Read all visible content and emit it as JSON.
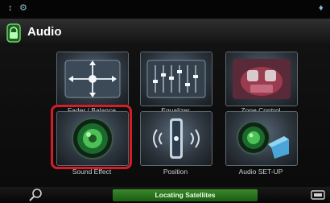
{
  "status_bar": {
    "icon_left": "↕",
    "icon_mid": "⚙",
    "icon_right": "♦"
  },
  "header": {
    "title": "Audio"
  },
  "tiles": [
    {
      "label": "Fader / Balance",
      "icon": "fader-balance-icon"
    },
    {
      "label": "Equalizer",
      "icon": "equalizer-icon"
    },
    {
      "label": "Zone Control",
      "icon": "zone-control-icon"
    },
    {
      "label": "Sound Effect",
      "icon": "speaker-icon"
    },
    {
      "label": "Position",
      "icon": "position-icon"
    },
    {
      "label": "Audio SET-UP",
      "icon": "audio-setup-icon"
    }
  ],
  "bottom_bar": {
    "status_text": "Locating Satellites"
  },
  "colors": {
    "highlight": "#d51d2a",
    "accent_green": "#3a8a2a"
  }
}
